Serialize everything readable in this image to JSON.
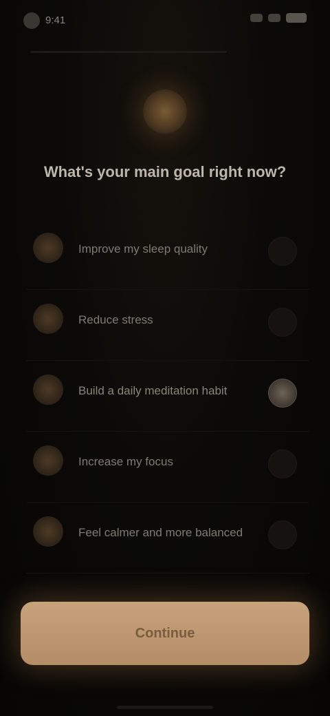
{
  "status_bar": {
    "time": "9:41"
  },
  "hero": {
    "icon": "sparkle-icon",
    "headline": "What's your main goal right now?",
    "headline_sub": ""
  },
  "options": [
    {
      "label": "Improve my sleep quality",
      "icon": "moon-icon",
      "selected": false
    },
    {
      "label": "Reduce stress",
      "icon": "leaf-icon",
      "selected": false
    },
    {
      "label": "Build a daily meditation habit",
      "icon": "lotus-icon",
      "selected": true
    },
    {
      "label": "Increase my focus",
      "icon": "target-icon",
      "selected": false
    },
    {
      "label": "Feel calmer and more balanced",
      "icon": "balance-icon",
      "selected": false
    }
  ],
  "cta": {
    "label": "Continue"
  },
  "colors": {
    "accent": "#c7a27a",
    "background": "#0a0907"
  }
}
